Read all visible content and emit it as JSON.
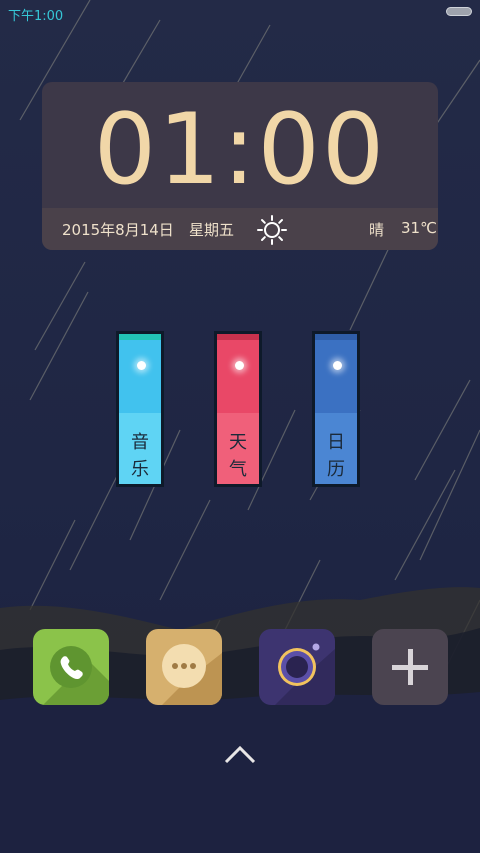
{
  "status_bar": {
    "time": "下午1:00"
  },
  "clock": {
    "time": "01:00",
    "date": "2015年8月14日",
    "weekday": "星期五",
    "weather_icon": "sun-icon",
    "weather": "晴",
    "temperature": "31℃"
  },
  "tiles": [
    {
      "name": "music",
      "label_line1": "音",
      "label_line2": "乐"
    },
    {
      "name": "weather",
      "label_line1": "天",
      "label_line2": "气"
    },
    {
      "name": "calendar",
      "label_line1": "日",
      "label_line2": "历"
    }
  ],
  "dock": [
    {
      "name": "phone",
      "icon": "phone-icon"
    },
    {
      "name": "messages",
      "icon": "chat-bubble-icon"
    },
    {
      "name": "camera",
      "icon": "camera-lens-icon"
    },
    {
      "name": "add",
      "icon": "plus-icon"
    }
  ],
  "colors": {
    "clock_digits": "#f1d7a8",
    "music_tile": "#44c6ee",
    "weather_tile": "#eb4d6b",
    "calendar_tile": "#3f7ecb",
    "status_time": "#36c6d6"
  }
}
